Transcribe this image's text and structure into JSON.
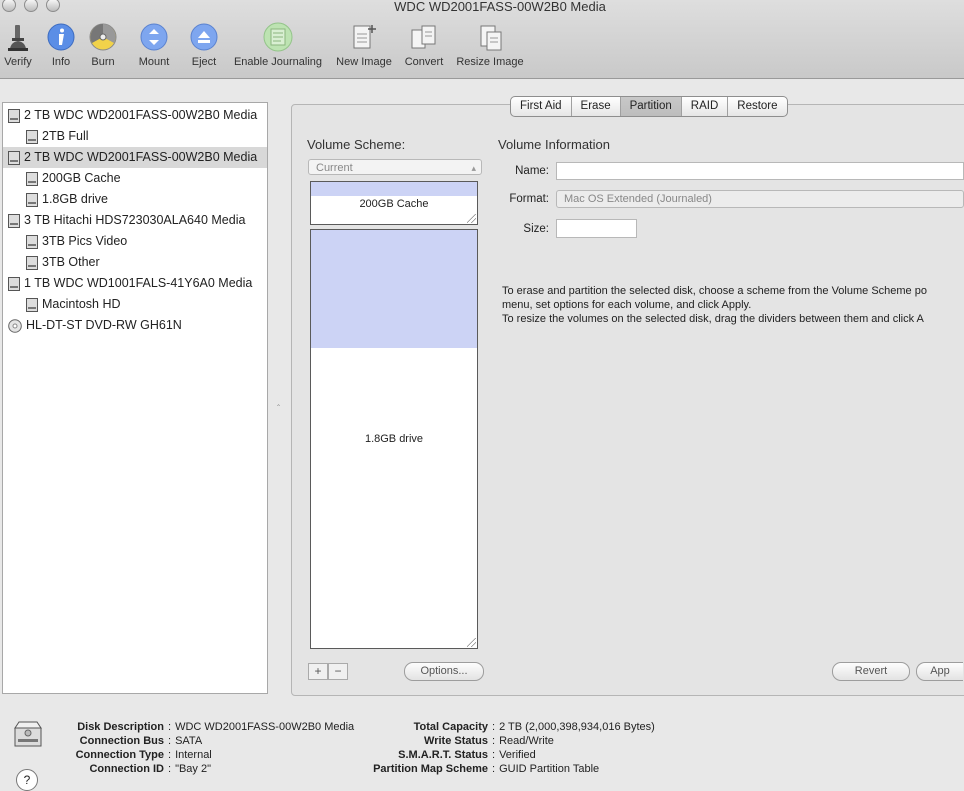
{
  "window": {
    "title": "WDC WD2001FASS-00W2B0 Media"
  },
  "toolbar": {
    "verify": "Verify",
    "info": "Info",
    "burn": "Burn",
    "mount": "Mount",
    "eject": "Eject",
    "enable_journaling": "Enable Journaling",
    "new_image": "New Image",
    "convert": "Convert",
    "resize_image": "Resize Image"
  },
  "sidebar": {
    "items": [
      {
        "label": "2 TB WDC WD2001FASS-00W2B0 Media"
      },
      {
        "label": "2TB Full"
      },
      {
        "label": "2 TB WDC WD2001FASS-00W2B0 Media"
      },
      {
        "label": "200GB Cache"
      },
      {
        "label": "1.8GB drive"
      },
      {
        "label": "3 TB Hitachi HDS723030ALA640 Media"
      },
      {
        "label": "3TB Pics Video"
      },
      {
        "label": "3TB Other"
      },
      {
        "label": "1 TB WDC WD1001FALS-41Y6A0 Media"
      },
      {
        "label": "Macintosh HD"
      },
      {
        "label": "HL-DT-ST DVD-RW GH61N"
      }
    ]
  },
  "tabs": {
    "first_aid": "First Aid",
    "erase": "Erase",
    "partition": "Partition",
    "raid": "RAID",
    "restore": "Restore"
  },
  "partition": {
    "volume_scheme_label": "Volume Scheme:",
    "scheme_value": "Current",
    "volume_info_label": "Volume Information",
    "name_label": "Name:",
    "format_label": "Format:",
    "format_value": "Mac OS Extended (Journaled)",
    "size_label": "Size:",
    "partitions": [
      {
        "label": "200GB Cache"
      },
      {
        "label": "1.8GB drive"
      }
    ],
    "help_line1": "To erase and partition the selected disk, choose a scheme from the Volume Scheme po",
    "help_line2": "menu, set options for each volume, and click Apply.",
    "help_line3": "To resize the volumes on the selected disk, drag the dividers between them and click A",
    "add_symbol": "+",
    "remove_symbol": "−",
    "options_label": "Options...",
    "revert_label": "Revert",
    "apply_label": "App"
  },
  "info": {
    "left": [
      {
        "key": "Disk Description",
        "value": "WDC WD2001FASS-00W2B0 Media"
      },
      {
        "key": "Connection Bus",
        "value": "SATA"
      },
      {
        "key": "Connection Type",
        "value": "Internal"
      },
      {
        "key": "Connection ID",
        "value": "\"Bay 2\""
      }
    ],
    "right": [
      {
        "key": "Total Capacity",
        "value": "2 TB (2,000,398,934,016 Bytes)"
      },
      {
        "key": "Write Status",
        "value": "Read/Write"
      },
      {
        "key": "S.M.A.R.T. Status",
        "value": "Verified"
      },
      {
        "key": "Partition Map Scheme",
        "value": "GUID Partition Table"
      }
    ],
    "colon": ":",
    "help_symbol": "?"
  }
}
